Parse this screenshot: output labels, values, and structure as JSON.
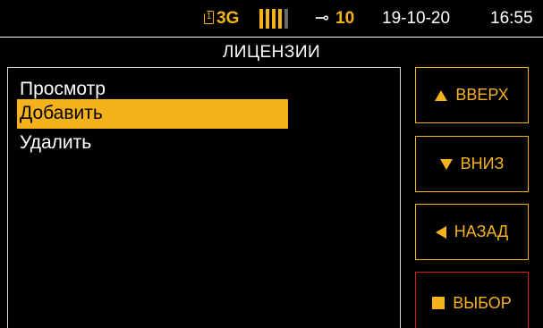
{
  "status_bar": {
    "sim_slot": "1",
    "network": "3G",
    "signal_bars_active": 4,
    "battery_level": "10",
    "date": "19-10-20",
    "time": "16:55"
  },
  "screen": {
    "title": "ЛИЦЕНЗИИ"
  },
  "menu": {
    "items": [
      {
        "label": "Просмотр",
        "selected": false
      },
      {
        "label": "Добавить",
        "selected": true
      },
      {
        "label": "Удалить",
        "selected": false
      }
    ]
  },
  "buttons": {
    "up": {
      "label": "ВВЕРХ",
      "icon": "triangle-up-icon"
    },
    "down": {
      "label": "ВНИЗ",
      "icon": "triangle-down-icon"
    },
    "back": {
      "label": "НАЗАД",
      "icon": "triangle-left-icon"
    },
    "select": {
      "label": "ВЫБОР",
      "icon": "square-icon"
    }
  },
  "colors": {
    "accent": "#f5b21a",
    "select_border": "#e0161b",
    "background": "#000000",
    "text": "#ffffff"
  }
}
